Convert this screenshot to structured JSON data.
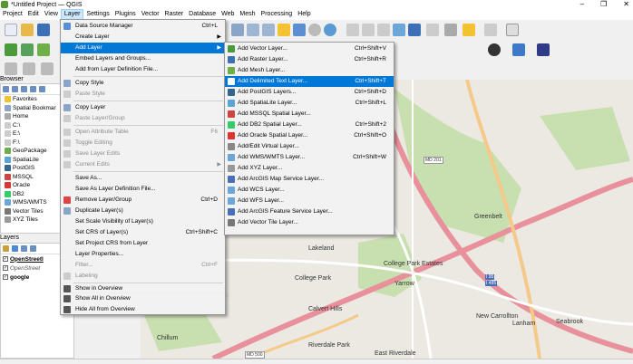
{
  "window": {
    "title": "*Untitled Project — QGIS",
    "minimize": "–",
    "maximize": "❐",
    "close": "✕"
  },
  "menubar": [
    "Project",
    "Edit",
    "View",
    "Layer",
    "Settings",
    "Plugins",
    "Vector",
    "Raster",
    "Database",
    "Web",
    "Mesh",
    "Processing",
    "Help"
  ],
  "browser": {
    "title": "Browser",
    "items": [
      "Favorites",
      "Spatial Bookmar",
      "Home",
      "C:\\",
      "E:\\",
      "F:\\",
      "GeoPackage",
      "SpatiaLite",
      "PostGIS",
      "MSSQL",
      "Oracle",
      "DB2",
      "WMS/WMTS",
      "Vector Tiles",
      "XYZ Tiles"
    ]
  },
  "layers": {
    "title": "Layers",
    "items": [
      {
        "name": "OpenStreetl",
        "checked": true
      },
      {
        "name": "OpenStreet",
        "checked": true
      },
      {
        "name": "google",
        "checked": true
      }
    ]
  },
  "layer_menu": {
    "items": [
      {
        "label": "Data Source Manager",
        "shortcut": "Ctrl+L",
        "icon": "data-source-icon",
        "disabled": false
      },
      {
        "label": "Create Layer",
        "shortcut": "",
        "submenu": true
      },
      {
        "label": "Add Layer",
        "shortcut": "",
        "submenu": true,
        "highlighted": true
      },
      {
        "label": "Embed Layers and Groups...",
        "shortcut": ""
      },
      {
        "label": "Add from Layer Definition File...",
        "shortcut": ""
      },
      {
        "label": "Copy Style",
        "shortcut": "",
        "icon": "copy-style-icon"
      },
      {
        "label": "Paste Style",
        "shortcut": "",
        "disabled": true,
        "icon": "paste-style-icon"
      },
      {
        "label": "Copy Layer",
        "shortcut": "",
        "icon": "copy-layer-icon"
      },
      {
        "label": "Paste Layer/Group",
        "shortcut": "",
        "disabled": true,
        "icon": "paste-layer-icon"
      },
      {
        "label": "Open Attribute Table",
        "shortcut": "F6",
        "disabled": true,
        "icon": "table-icon"
      },
      {
        "label": "Toggle Editing",
        "shortcut": "",
        "disabled": true,
        "icon": "pencil-icon"
      },
      {
        "label": "Save Layer Edits",
        "shortcut": "",
        "disabled": true,
        "icon": "save-edits-icon"
      },
      {
        "label": "Current Edits",
        "shortcut": "",
        "disabled": true,
        "submenu": true,
        "icon": "current-edits-icon"
      },
      {
        "label": "Save As...",
        "shortcut": ""
      },
      {
        "label": "Save As Layer Definition File...",
        "shortcut": ""
      },
      {
        "label": "Remove Layer/Group",
        "shortcut": "Ctrl+D",
        "icon": "remove-layer-icon"
      },
      {
        "label": "Duplicate Layer(s)",
        "shortcut": "",
        "icon": "duplicate-layer-icon"
      },
      {
        "label": "Set Scale Visibility of Layer(s)",
        "shortcut": ""
      },
      {
        "label": "Set CRS of Layer(s)",
        "shortcut": "Ctrl+Shift+C"
      },
      {
        "label": "Set Project CRS from Layer",
        "shortcut": ""
      },
      {
        "label": "Layer Properties...",
        "shortcut": ""
      },
      {
        "label": "Filter...",
        "shortcut": "Ctrl+F",
        "disabled": true
      },
      {
        "label": "Labeling",
        "shortcut": "",
        "disabled": true,
        "icon": "labeling-icon"
      },
      {
        "label": "Show in Overview",
        "shortcut": "",
        "icon": "overview-icon"
      },
      {
        "label": "Show All in Overview",
        "shortcut": "",
        "icon": "overview-all-icon"
      },
      {
        "label": "Hide All from Overview",
        "shortcut": "",
        "icon": "overview-hide-icon"
      }
    ]
  },
  "add_layer_menu": {
    "items": [
      {
        "label": "Add Vector Layer...",
        "shortcut": "Ctrl+Shift+V",
        "icon": "vector-layer-icon"
      },
      {
        "label": "Add Raster Layer...",
        "shortcut": "Ctrl+Shift+R",
        "icon": "raster-layer-icon"
      },
      {
        "label": "Add Mesh Layer...",
        "shortcut": "",
        "icon": "mesh-layer-icon"
      },
      {
        "label": "Add Delimited Text Layer...",
        "shortcut": "Ctrl+Shift+T",
        "icon": "delimited-text-icon",
        "highlighted": true
      },
      {
        "label": "Add PostGIS Layers...",
        "shortcut": "Ctrl+Shift+D",
        "icon": "postgis-icon"
      },
      {
        "label": "Add SpatiaLite Layer...",
        "shortcut": "Ctrl+Shift+L",
        "icon": "spatialite-icon"
      },
      {
        "label": "Add MSSQL Spatial Layer...",
        "shortcut": "",
        "icon": "mssql-icon"
      },
      {
        "label": "Add DB2 Spatial Layer...",
        "shortcut": "Ctrl+Shift+2",
        "icon": "db2-icon"
      },
      {
        "label": "Add Oracle Spatial Layer...",
        "shortcut": "Ctrl+Shift+O",
        "icon": "oracle-icon"
      },
      {
        "label": "Add/Edit Virtual Layer...",
        "shortcut": "",
        "icon": "virtual-layer-icon"
      },
      {
        "label": "Add WMS/WMTS Layer...",
        "shortcut": "Ctrl+Shift+W",
        "icon": "wms-icon"
      },
      {
        "label": "Add XYZ Layer...",
        "shortcut": "",
        "icon": "xyz-icon"
      },
      {
        "label": "Add ArcGIS Map Service Layer...",
        "shortcut": "",
        "icon": "arcgis-map-icon"
      },
      {
        "label": "Add WCS Layer...",
        "shortcut": "",
        "icon": "wcs-icon"
      },
      {
        "label": "Add WFS Layer...",
        "shortcut": "",
        "icon": "wfs-icon"
      },
      {
        "label": "Add ArcGIS Feature Service Layer...",
        "shortcut": "",
        "icon": "arcgis-feature-icon"
      },
      {
        "label": "Add Vector Tile Layer...",
        "shortcut": "",
        "icon": "vector-tile-icon"
      }
    ]
  },
  "map_labels": [
    "Greenbelt",
    "Lakeland",
    "College Park Estates",
    "College Park",
    "Yarrow",
    "Calvert Hills",
    "New Carrollton",
    "Lanham",
    "Seabrook",
    "Chillum",
    "Riverdale Park",
    "East Riverdale",
    "MD 201",
    "MD 500",
    "I 95",
    "I 495"
  ],
  "colors": {
    "accent": "#0078d7",
    "menu_bg": "#f2f2f2",
    "map_bg": "#ece9e2",
    "highway": "#e8909c",
    "park": "#c8dfb0"
  }
}
